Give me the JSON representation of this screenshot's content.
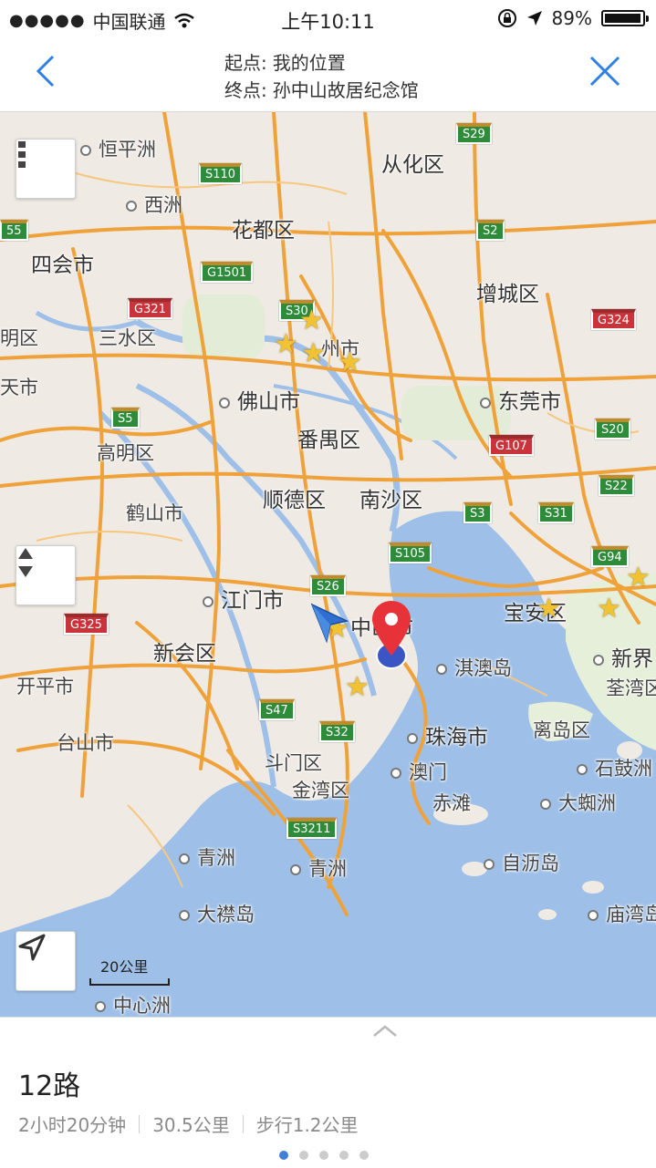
{
  "status": {
    "carrier": "中国联通",
    "time": "上午10:11",
    "battery": "89%"
  },
  "header": {
    "start_label": "起点:",
    "start_value": "我的位置",
    "end_label": "终点:",
    "end_value": "孙中山故居纪念馆"
  },
  "map": {
    "places": {
      "hengpingzhou": "恒平洲",
      "xizhou": "西洲",
      "conghua": "从化区",
      "huadu": "花都区",
      "sihui": "四会市",
      "zengcheng": "增城区",
      "xuanqu": "明区",
      "sanshui": "三水区",
      "guangzhou": "州市",
      "tianshi": "天市",
      "foshan": "佛山市",
      "dongguan": "东莞市",
      "panyu": "番禺区",
      "gaoming": "高明区",
      "heshan": "鹤山市",
      "shunde": "顺德区",
      "nansha": "南沙区",
      "jiangmen": "江门市",
      "zhongshan": "中山市",
      "baoan": "宝安区",
      "xinjie": "新界",
      "xinhui": "新会区",
      "qiao": "淇澳岛",
      "kaiping": "开平市",
      "quanwan": "荃湾区",
      "taishan": "台山市",
      "zhuhai": "珠海市",
      "lidao": "离岛区",
      "doumen": "斗门区",
      "shigu": "石鼓洲",
      "aomen": "澳门",
      "jinwan": "金湾区",
      "chitan": "赤滩",
      "daxuzhou": "大蜘洲",
      "qingzhou1": "青洲",
      "qingzhou2": "青洲",
      "zilidao": "自沥岛",
      "daxindao": "大襟岛",
      "tangjiao": "庙湾岛",
      "zhongxinzhou": "中心洲"
    },
    "shields": {
      "s29": "S29",
      "s110": "S110",
      "s2": "S2",
      "g1501": "G1501",
      "g321": "G321",
      "s30": "S30",
      "g324": "G324",
      "s5": "S5",
      "s20": "S20",
      "g107": "G107",
      "s22": "S22",
      "s3": "S3",
      "s31": "S31",
      "s105": "S105",
      "g94": "G94",
      "s26": "S26",
      "g325": "G325",
      "s47": "S47",
      "s32": "S32",
      "s3211": "S3211",
      "s55": "55"
    },
    "scale": "20公里"
  },
  "route": {
    "name": "12路",
    "duration": "2小时20分钟",
    "distance": "30.5公里",
    "walk": "步行1.2公里"
  },
  "colors": {
    "road": "#f0a23a",
    "water": "#9ec0e8",
    "land": "#efeae4",
    "accent": "#3f7fd6",
    "pin": "#e8323a"
  }
}
